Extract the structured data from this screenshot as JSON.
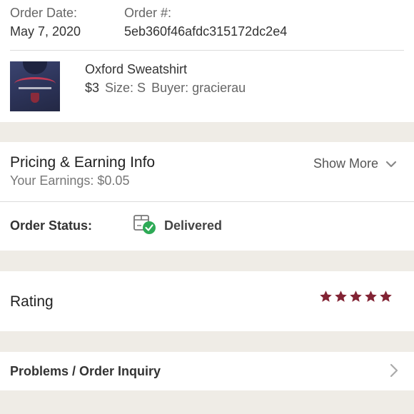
{
  "order": {
    "date_label": "Order Date:",
    "date_value": "May 7, 2020",
    "number_label": "Order #:",
    "number_value": "5eb360f46afdc315172dc2e4"
  },
  "item": {
    "title": "Oxford Sweatshirt",
    "price": "$3",
    "size": "Size: S",
    "buyer": "Buyer: gracierau"
  },
  "pricing": {
    "title": "Pricing & Earning Info",
    "earnings": "Your Earnings: $0.05",
    "show_more": "Show More"
  },
  "status": {
    "label": "Order Status:",
    "value": "Delivered",
    "check_color": "#2eaa56"
  },
  "rating": {
    "label": "Rating",
    "stars": 5,
    "max_stars": 5,
    "star_color": "#822334"
  },
  "problems": {
    "label": "Problems / Order Inquiry"
  }
}
